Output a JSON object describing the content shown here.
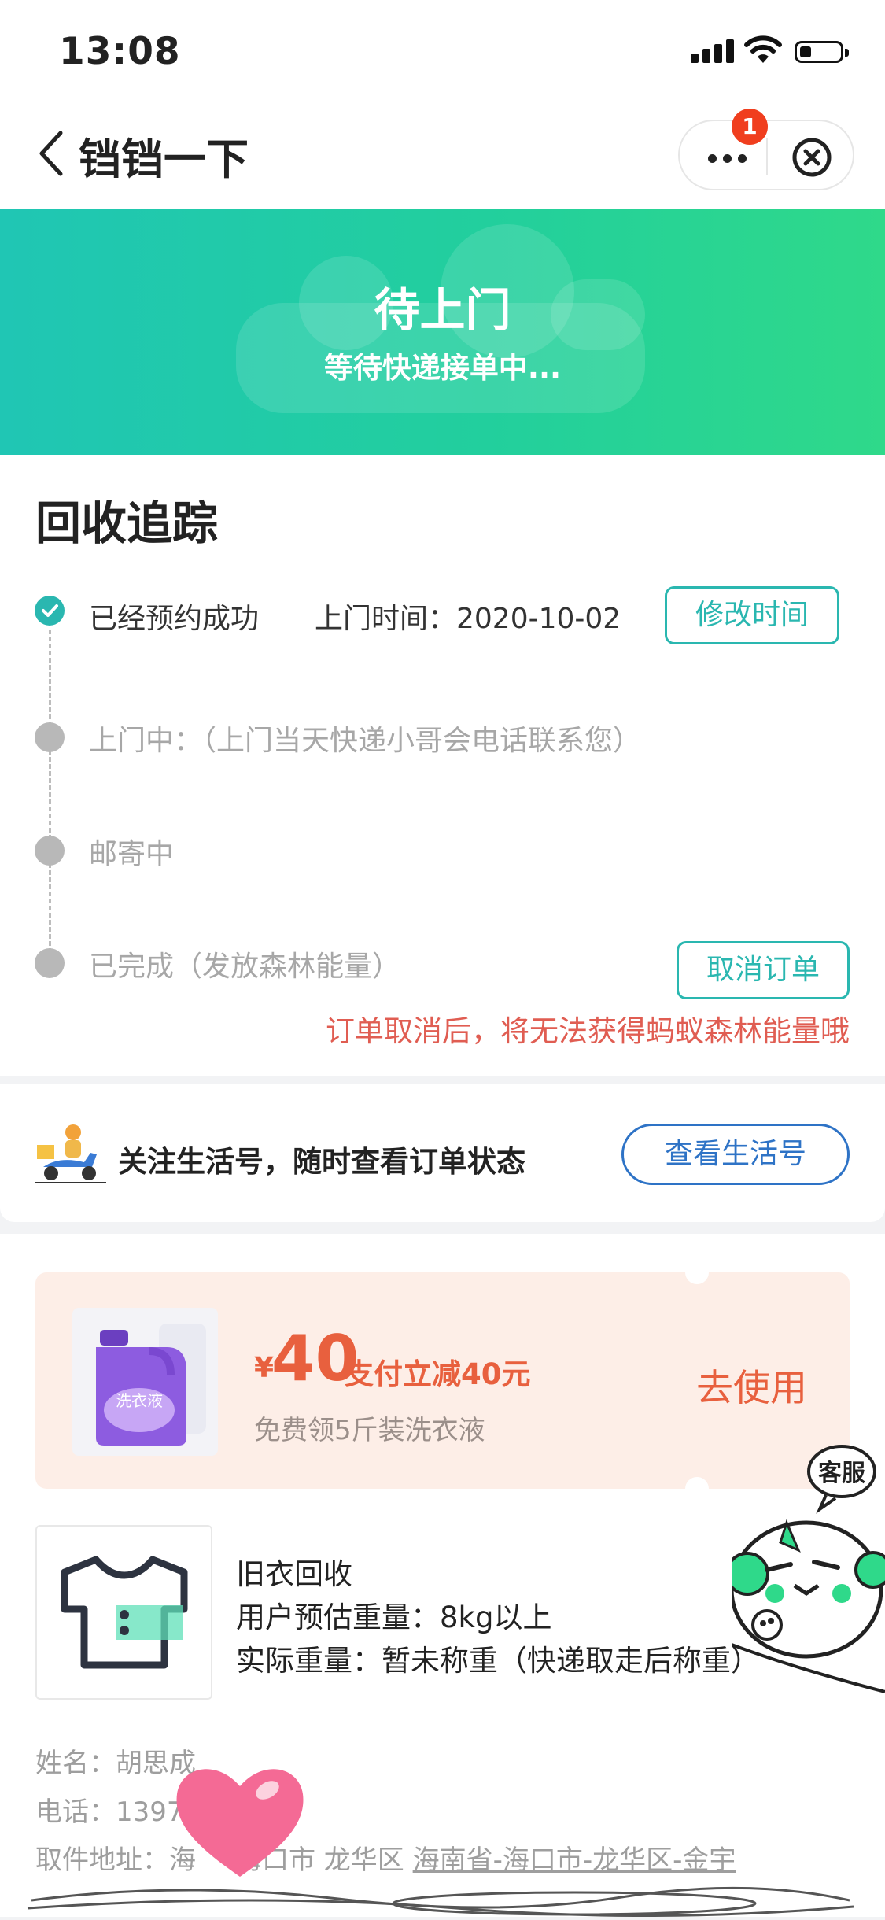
{
  "status_bar": {
    "time": "13:08"
  },
  "nav": {
    "title": "铛铛一下",
    "badge_count": "1"
  },
  "banner": {
    "title": "待上门",
    "subtitle": "等待快递接单中..."
  },
  "tracking": {
    "title": "回收追踪",
    "steps": [
      {
        "label": "已经预约成功",
        "time_label": "上门时间：2020-10-02",
        "status": "done"
      },
      {
        "label": "上门中：（上门当天快递小哥会电话联系您）",
        "status": "pending"
      },
      {
        "label": "邮寄中",
        "status": "pending"
      },
      {
        "label": "已完成（发放森林能量）",
        "status": "pending"
      }
    ],
    "modify_time_button": "修改时间",
    "cancel_order_button": "取消订单",
    "cancel_warning": "订单取消后，将无法获得蚂蚁森林能量哦"
  },
  "follow": {
    "text": "关注生活号，随时查看订单状态",
    "button": "查看生活号"
  },
  "coupon": {
    "currency": "¥",
    "amount": "40",
    "desc": "支付立减40元",
    "sub": "免费领5斤装洗衣液",
    "use_button": "去使用",
    "product_label": "洗衣液"
  },
  "item": {
    "name": "旧衣回收",
    "estimated_weight": "用户预估重量：8kg以上",
    "actual_weight": "实际重量：暂未称重（快递取走后称重）"
  },
  "customer_service": {
    "label": "客服"
  },
  "contact": {
    "name": "姓名：胡思成",
    "phone": "电话：1397",
    "address_prefix": "取件地址：海",
    "address_visible": "海口市 龙华区",
    "address_detail": "海南省-海口市-龙华区-金宇"
  },
  "colors": {
    "teal": "#2ab7b0",
    "banner_start": "#20c6b4",
    "banner_end": "#2fd98a",
    "warning": "#e05d52",
    "coupon": "#e8603e",
    "link_blue": "#2e73c6"
  }
}
